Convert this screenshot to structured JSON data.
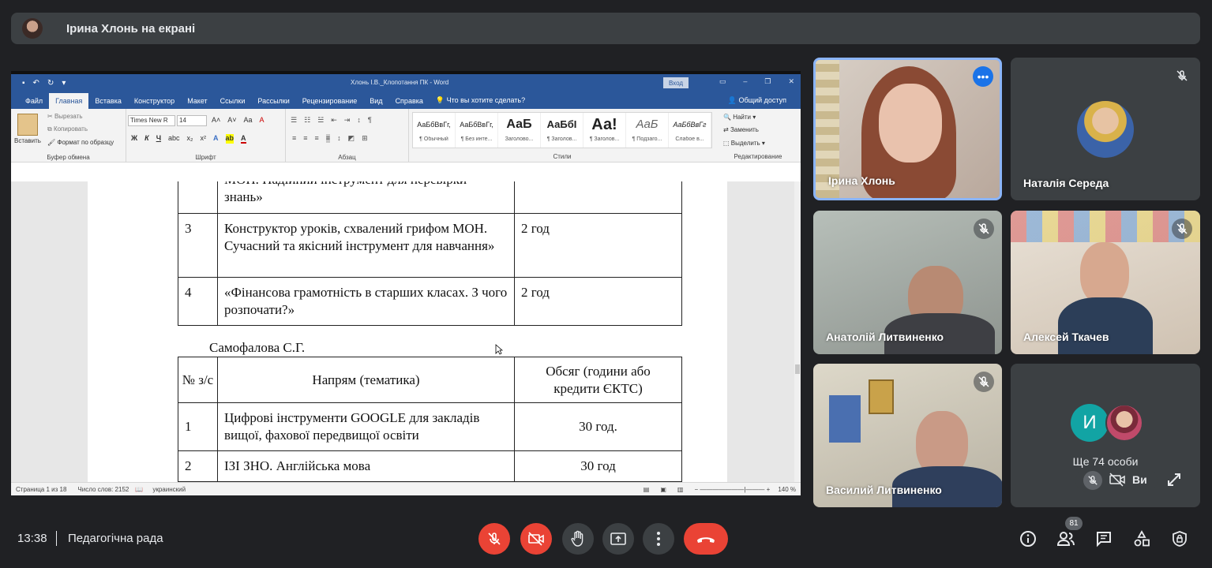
{
  "banner": {
    "title": "Ірина Хлонь на екрані"
  },
  "word": {
    "doc_title": "Хлонь І.В._Клопотання ПК - Word",
    "login": "Вход",
    "tabs": [
      "Файл",
      "Главная",
      "Вставка",
      "Конструктор",
      "Макет",
      "Ссылки",
      "Рассылки",
      "Рецензирование",
      "Вид",
      "Справка",
      "Что вы хотите сделать?"
    ],
    "share": "Общий доступ",
    "clipboard": {
      "paste": "Вставить",
      "cut": "Вырезать",
      "copy": "Копировать",
      "format": "Формат по образцу",
      "group": "Буфер обмена"
    },
    "font": {
      "name": "Times New R",
      "size": "14",
      "group": "Шрифт"
    },
    "paragraph_group": "Абзац",
    "styles": [
      {
        "sample": "АаБбВвГг,",
        "name": "¶ Обычный"
      },
      {
        "sample": "АаБбВвГг,",
        "name": "¶ Без инте..."
      },
      {
        "sample": "АаБ",
        "name": "Заголово..."
      },
      {
        "sample": "АаБбI",
        "name": "¶ Заголов..."
      },
      {
        "sample": "Аа!",
        "name": "¶ Заголов..."
      },
      {
        "sample": "АаБ",
        "name": "¶ Подзаго..."
      },
      {
        "sample": "АаБбВвГг",
        "name": "Слабое в..."
      }
    ],
    "styles_group": "Стили",
    "editing": {
      "find": "Найти",
      "replace": "Заменить",
      "select": "Выделить",
      "group": "Редактирование"
    },
    "table1": [
      {
        "num": "",
        "topic": "МОН. Надійний інструмент для перевірки знань»",
        "hours": ""
      },
      {
        "num": "3",
        "topic": "Конструктор уроків, схвалений грифом МОН. Сучасний та якісний інструмент для навчання»",
        "hours": "2 год"
      },
      {
        "num": "4",
        "topic": "«Фінансова грамотність в старших класах. З чого розпочати?»",
        "hours": "2 год"
      }
    ],
    "signature": "Самофалова С.Г.",
    "table2_header": {
      "num": "№ з/с",
      "topic": "Напрям (тематика)",
      "hours": "Обсяг (години або кредити ЄКТС)"
    },
    "table2": [
      {
        "num": "1",
        "topic": "Цифрові інструменти GOOGLE для закладів вищої, фахової передвищої освіти",
        "hours": "30 год."
      },
      {
        "num": "2",
        "topic": "ІЗІ ЗНО. Англійська мова",
        "hours": "30 год"
      }
    ],
    "status": {
      "page": "Страница 1 из 18",
      "words": "Число слов: 2152",
      "lang": "украинский",
      "zoom": "140 %"
    }
  },
  "participants": [
    {
      "name": "Ірина Хлонь"
    },
    {
      "name": "Наталія Середа"
    },
    {
      "name": "Анатолій Литвиненко"
    },
    {
      "name": "Алексей Ткачев"
    },
    {
      "name": "Василий Литвиненко"
    }
  ],
  "others": {
    "initial": "И",
    "label": "Ще 74 особи",
    "you": "Ви"
  },
  "bottom": {
    "time": "13:38",
    "meeting": "Педагогічна рада",
    "people_count": "81"
  },
  "colors": {
    "bg": "#202124",
    "tile": "#3c4043",
    "red": "#ea4335",
    "word_blue": "#2b579a",
    "active_border": "#8ab4f8",
    "teal_avatar": "#12a4a4"
  }
}
